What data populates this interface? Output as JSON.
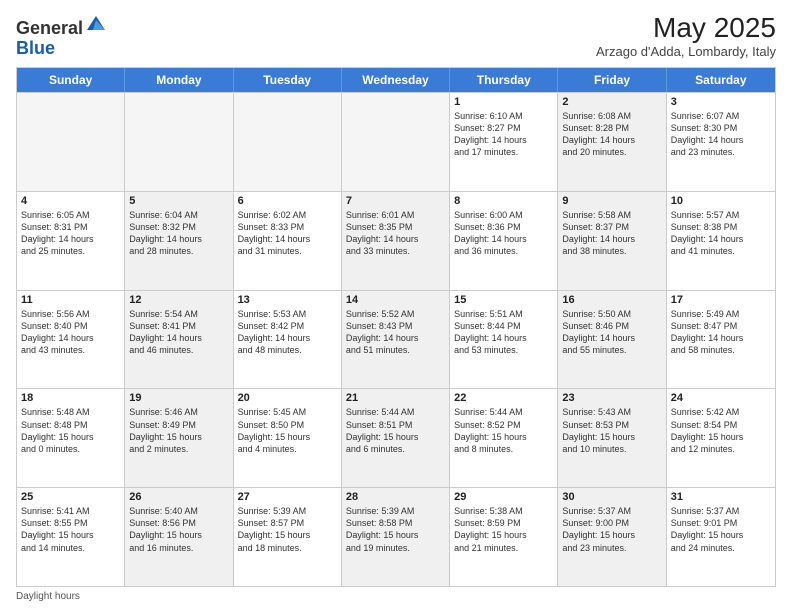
{
  "header": {
    "logo_general": "General",
    "logo_blue": "Blue",
    "month_year": "May 2025",
    "location": "Arzago d'Adda, Lombardy, Italy"
  },
  "days_of_week": [
    "Sunday",
    "Monday",
    "Tuesday",
    "Wednesday",
    "Thursday",
    "Friday",
    "Saturday"
  ],
  "footer": {
    "daylight_label": "Daylight hours"
  },
  "weeks": [
    [
      {
        "day": "",
        "text": "",
        "empty": true
      },
      {
        "day": "",
        "text": "",
        "empty": true
      },
      {
        "day": "",
        "text": "",
        "empty": true
      },
      {
        "day": "",
        "text": "",
        "empty": true
      },
      {
        "day": "1",
        "text": "Sunrise: 6:10 AM\nSunset: 8:27 PM\nDaylight: 14 hours\nand 17 minutes.",
        "empty": false,
        "shaded": false
      },
      {
        "day": "2",
        "text": "Sunrise: 6:08 AM\nSunset: 8:28 PM\nDaylight: 14 hours\nand 20 minutes.",
        "empty": false,
        "shaded": true
      },
      {
        "day": "3",
        "text": "Sunrise: 6:07 AM\nSunset: 8:30 PM\nDaylight: 14 hours\nand 23 minutes.",
        "empty": false,
        "shaded": false
      }
    ],
    [
      {
        "day": "4",
        "text": "Sunrise: 6:05 AM\nSunset: 8:31 PM\nDaylight: 14 hours\nand 25 minutes.",
        "empty": false,
        "shaded": false
      },
      {
        "day": "5",
        "text": "Sunrise: 6:04 AM\nSunset: 8:32 PM\nDaylight: 14 hours\nand 28 minutes.",
        "empty": false,
        "shaded": true
      },
      {
        "day": "6",
        "text": "Sunrise: 6:02 AM\nSunset: 8:33 PM\nDaylight: 14 hours\nand 31 minutes.",
        "empty": false,
        "shaded": false
      },
      {
        "day": "7",
        "text": "Sunrise: 6:01 AM\nSunset: 8:35 PM\nDaylight: 14 hours\nand 33 minutes.",
        "empty": false,
        "shaded": true
      },
      {
        "day": "8",
        "text": "Sunrise: 6:00 AM\nSunset: 8:36 PM\nDaylight: 14 hours\nand 36 minutes.",
        "empty": false,
        "shaded": false
      },
      {
        "day": "9",
        "text": "Sunrise: 5:58 AM\nSunset: 8:37 PM\nDaylight: 14 hours\nand 38 minutes.",
        "empty": false,
        "shaded": true
      },
      {
        "day": "10",
        "text": "Sunrise: 5:57 AM\nSunset: 8:38 PM\nDaylight: 14 hours\nand 41 minutes.",
        "empty": false,
        "shaded": false
      }
    ],
    [
      {
        "day": "11",
        "text": "Sunrise: 5:56 AM\nSunset: 8:40 PM\nDaylight: 14 hours\nand 43 minutes.",
        "empty": false,
        "shaded": false
      },
      {
        "day": "12",
        "text": "Sunrise: 5:54 AM\nSunset: 8:41 PM\nDaylight: 14 hours\nand 46 minutes.",
        "empty": false,
        "shaded": true
      },
      {
        "day": "13",
        "text": "Sunrise: 5:53 AM\nSunset: 8:42 PM\nDaylight: 14 hours\nand 48 minutes.",
        "empty": false,
        "shaded": false
      },
      {
        "day": "14",
        "text": "Sunrise: 5:52 AM\nSunset: 8:43 PM\nDaylight: 14 hours\nand 51 minutes.",
        "empty": false,
        "shaded": true
      },
      {
        "day": "15",
        "text": "Sunrise: 5:51 AM\nSunset: 8:44 PM\nDaylight: 14 hours\nand 53 minutes.",
        "empty": false,
        "shaded": false
      },
      {
        "day": "16",
        "text": "Sunrise: 5:50 AM\nSunset: 8:46 PM\nDaylight: 14 hours\nand 55 minutes.",
        "empty": false,
        "shaded": true
      },
      {
        "day": "17",
        "text": "Sunrise: 5:49 AM\nSunset: 8:47 PM\nDaylight: 14 hours\nand 58 minutes.",
        "empty": false,
        "shaded": false
      }
    ],
    [
      {
        "day": "18",
        "text": "Sunrise: 5:48 AM\nSunset: 8:48 PM\nDaylight: 15 hours\nand 0 minutes.",
        "empty": false,
        "shaded": false
      },
      {
        "day": "19",
        "text": "Sunrise: 5:46 AM\nSunset: 8:49 PM\nDaylight: 15 hours\nand 2 minutes.",
        "empty": false,
        "shaded": true
      },
      {
        "day": "20",
        "text": "Sunrise: 5:45 AM\nSunset: 8:50 PM\nDaylight: 15 hours\nand 4 minutes.",
        "empty": false,
        "shaded": false
      },
      {
        "day": "21",
        "text": "Sunrise: 5:44 AM\nSunset: 8:51 PM\nDaylight: 15 hours\nand 6 minutes.",
        "empty": false,
        "shaded": true
      },
      {
        "day": "22",
        "text": "Sunrise: 5:44 AM\nSunset: 8:52 PM\nDaylight: 15 hours\nand 8 minutes.",
        "empty": false,
        "shaded": false
      },
      {
        "day": "23",
        "text": "Sunrise: 5:43 AM\nSunset: 8:53 PM\nDaylight: 15 hours\nand 10 minutes.",
        "empty": false,
        "shaded": true
      },
      {
        "day": "24",
        "text": "Sunrise: 5:42 AM\nSunset: 8:54 PM\nDaylight: 15 hours\nand 12 minutes.",
        "empty": false,
        "shaded": false
      }
    ],
    [
      {
        "day": "25",
        "text": "Sunrise: 5:41 AM\nSunset: 8:55 PM\nDaylight: 15 hours\nand 14 minutes.",
        "empty": false,
        "shaded": false
      },
      {
        "day": "26",
        "text": "Sunrise: 5:40 AM\nSunset: 8:56 PM\nDaylight: 15 hours\nand 16 minutes.",
        "empty": false,
        "shaded": true
      },
      {
        "day": "27",
        "text": "Sunrise: 5:39 AM\nSunset: 8:57 PM\nDaylight: 15 hours\nand 18 minutes.",
        "empty": false,
        "shaded": false
      },
      {
        "day": "28",
        "text": "Sunrise: 5:39 AM\nSunset: 8:58 PM\nDaylight: 15 hours\nand 19 minutes.",
        "empty": false,
        "shaded": true
      },
      {
        "day": "29",
        "text": "Sunrise: 5:38 AM\nSunset: 8:59 PM\nDaylight: 15 hours\nand 21 minutes.",
        "empty": false,
        "shaded": false
      },
      {
        "day": "30",
        "text": "Sunrise: 5:37 AM\nSunset: 9:00 PM\nDaylight: 15 hours\nand 23 minutes.",
        "empty": false,
        "shaded": true
      },
      {
        "day": "31",
        "text": "Sunrise: 5:37 AM\nSunset: 9:01 PM\nDaylight: 15 hours\nand 24 minutes.",
        "empty": false,
        "shaded": false
      }
    ]
  ]
}
